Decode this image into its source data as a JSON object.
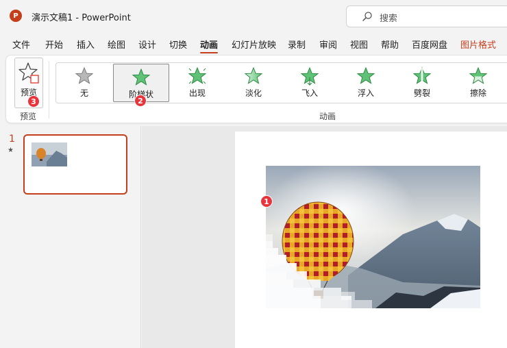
{
  "window": {
    "title": "演示文稿1  -  PowerPoint",
    "app_logo_letter": "P"
  },
  "search": {
    "label": "搜索"
  },
  "menu": {
    "items": [
      {
        "label": "文件"
      },
      {
        "label": "开始"
      },
      {
        "label": "插入"
      },
      {
        "label": "绘图"
      },
      {
        "label": "设计"
      },
      {
        "label": "切换"
      },
      {
        "label": "动画"
      },
      {
        "label": "幻灯片放映"
      },
      {
        "label": "录制"
      },
      {
        "label": "审阅"
      },
      {
        "label": "视图"
      },
      {
        "label": "帮助"
      },
      {
        "label": "百度网盘"
      },
      {
        "label": "图片格式"
      }
    ],
    "active": "动画",
    "contextual": "图片格式"
  },
  "ribbon": {
    "preview_button_label": "预览",
    "preview_group_label": "预览",
    "animation_group_label": "动画",
    "effects": [
      {
        "label": "无",
        "icon": "star-none-icon"
      },
      {
        "label": "阶梯状",
        "icon": "star-stairs-icon",
        "selected": true
      },
      {
        "label": "出现",
        "icon": "star-appear-icon"
      },
      {
        "label": "淡化",
        "icon": "star-fade-icon"
      },
      {
        "label": "飞入",
        "icon": "star-fly-in-icon"
      },
      {
        "label": "浮入",
        "icon": "star-float-in-icon"
      },
      {
        "label": "劈裂",
        "icon": "star-split-icon"
      },
      {
        "label": "擦除",
        "icon": "star-wipe-icon"
      }
    ]
  },
  "badges": {
    "b1": "1",
    "b2": "2",
    "b3": "3"
  },
  "thumbnails": {
    "slide_number": "1",
    "animation_marker": "★"
  },
  "colors": {
    "accent": "#c43e1c",
    "badge": "#e8343c",
    "star_green": "#3fae5a"
  }
}
